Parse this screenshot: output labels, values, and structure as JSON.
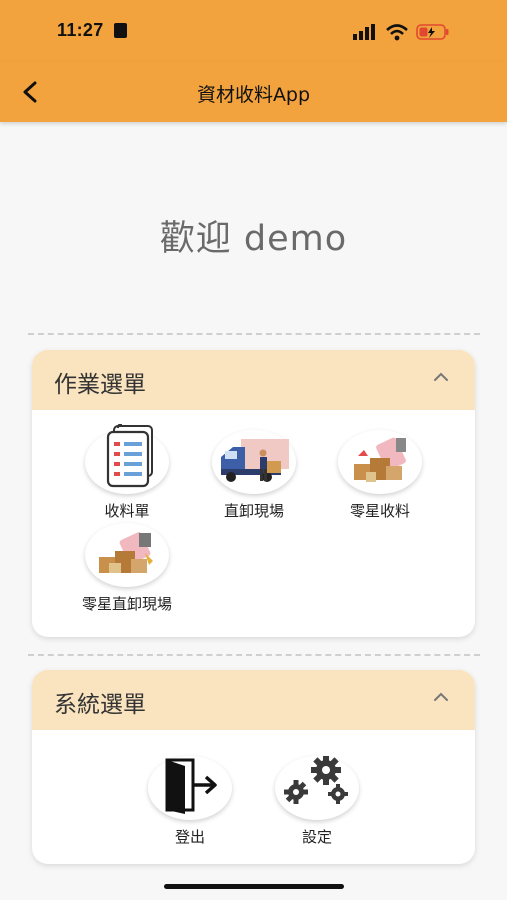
{
  "status_bar": {
    "time": "11:27"
  },
  "app_bar": {
    "title": "資材收料App"
  },
  "welcome_text": "歡迎 demo",
  "work_menu": {
    "title": "作業選單",
    "items": [
      {
        "label": "收料單",
        "icon": "receiving-list-icon"
      },
      {
        "label": "直卸現場",
        "icon": "direct-unload-truck-icon"
      },
      {
        "label": "零星收料",
        "icon": "sporadic-receiving-icon"
      },
      {
        "label": "零星直卸現場",
        "icon": "sporadic-direct-unload-icon"
      }
    ]
  },
  "system_menu": {
    "title": "系統選單",
    "items": [
      {
        "label": "登出",
        "icon": "logout-icon"
      },
      {
        "label": "設定",
        "icon": "settings-gears-icon"
      }
    ]
  },
  "colors": {
    "primary": "#f3a33e",
    "section_header": "#fae3bf"
  }
}
